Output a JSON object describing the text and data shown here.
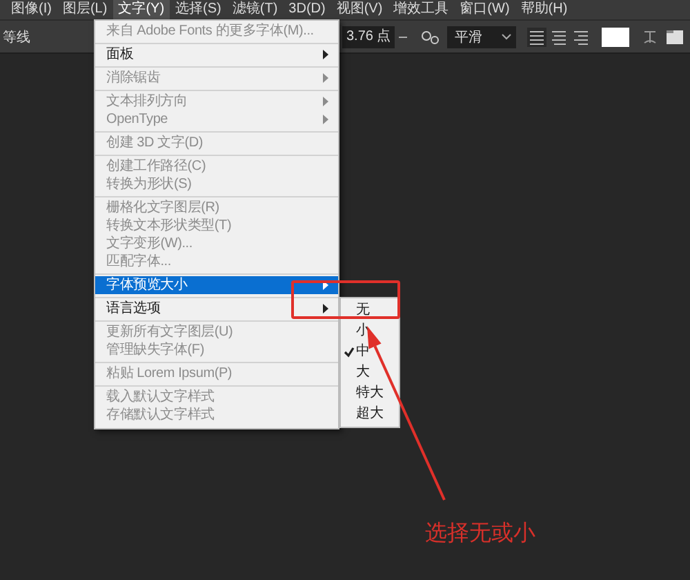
{
  "menubar": [
    {
      "label": "图像(I)",
      "selected": false
    },
    {
      "label": "图层(L)",
      "selected": false
    },
    {
      "label": "文字(Y)",
      "selected": true
    },
    {
      "label": "选择(S)",
      "selected": false
    },
    {
      "label": "滤镜(T)",
      "selected": false
    },
    {
      "label": "3D(D)",
      "selected": false
    },
    {
      "label": "视图(V)",
      "selected": false
    },
    {
      "label": "增效工具",
      "selected": false
    },
    {
      "label": "窗口(W)",
      "selected": false
    },
    {
      "label": "帮助(H)",
      "selected": false
    }
  ],
  "options_bar": {
    "font_family": "等线",
    "font_size": "3.76 点",
    "anti_alias": "平滑"
  },
  "type_menu": {
    "items": [
      {
        "kind": "item",
        "label": "来自 Adobe Fonts 的更多字体(M)...",
        "disabled": true,
        "submenu": false,
        "selected": false
      },
      {
        "kind": "separator"
      },
      {
        "kind": "item",
        "label": "面板",
        "disabled": false,
        "submenu": true,
        "selected": false
      },
      {
        "kind": "separator"
      },
      {
        "kind": "item",
        "label": "消除锯齿",
        "disabled": true,
        "submenu": true,
        "selected": false
      },
      {
        "kind": "separator"
      },
      {
        "kind": "item",
        "label": "文本排列方向",
        "disabled": true,
        "submenu": true,
        "selected": false
      },
      {
        "kind": "item",
        "label": "OpenType",
        "disabled": true,
        "submenu": true,
        "selected": false
      },
      {
        "kind": "separator"
      },
      {
        "kind": "item",
        "label": "创建 3D 文字(D)",
        "disabled": true,
        "submenu": false,
        "selected": false
      },
      {
        "kind": "separator"
      },
      {
        "kind": "item",
        "label": "创建工作路径(C)",
        "disabled": true,
        "submenu": false,
        "selected": false
      },
      {
        "kind": "item",
        "label": "转换为形状(S)",
        "disabled": true,
        "submenu": false,
        "selected": false
      },
      {
        "kind": "separator"
      },
      {
        "kind": "item",
        "label": "栅格化文字图层(R)",
        "disabled": true,
        "submenu": false,
        "selected": false
      },
      {
        "kind": "item",
        "label": "转换文本形状类型(T)",
        "disabled": true,
        "submenu": false,
        "selected": false
      },
      {
        "kind": "item",
        "label": "文字变形(W)...",
        "disabled": true,
        "submenu": false,
        "selected": false
      },
      {
        "kind": "item",
        "label": "匹配字体...",
        "disabled": true,
        "submenu": false,
        "selected": false
      },
      {
        "kind": "separator"
      },
      {
        "kind": "item",
        "label": "字体预览大小",
        "disabled": false,
        "submenu": true,
        "selected": true
      },
      {
        "kind": "separator"
      },
      {
        "kind": "item",
        "label": "语言选项",
        "disabled": false,
        "submenu": true,
        "selected": false
      },
      {
        "kind": "separator"
      },
      {
        "kind": "item",
        "label": "更新所有文字图层(U)",
        "disabled": true,
        "submenu": false,
        "selected": false
      },
      {
        "kind": "item",
        "label": "管理缺失字体(F)",
        "disabled": true,
        "submenu": false,
        "selected": false
      },
      {
        "kind": "separator"
      },
      {
        "kind": "item",
        "label": "粘贴 Lorem Ipsum(P)",
        "disabled": true,
        "submenu": false,
        "selected": false
      },
      {
        "kind": "separator"
      },
      {
        "kind": "item",
        "label": "载入默认文字样式",
        "disabled": true,
        "submenu": false,
        "selected": false
      },
      {
        "kind": "item",
        "label": "存储默认文字样式",
        "disabled": true,
        "submenu": false,
        "selected": false
      }
    ]
  },
  "preview_size_submenu": {
    "items": [
      {
        "label": "无",
        "checked": false
      },
      {
        "label": "小",
        "checked": false
      },
      {
        "label": "中",
        "checked": true
      },
      {
        "label": "大",
        "checked": false
      },
      {
        "label": "特大",
        "checked": false
      },
      {
        "label": "超大",
        "checked": false
      }
    ]
  },
  "annotation": {
    "text": "选择无或小"
  }
}
